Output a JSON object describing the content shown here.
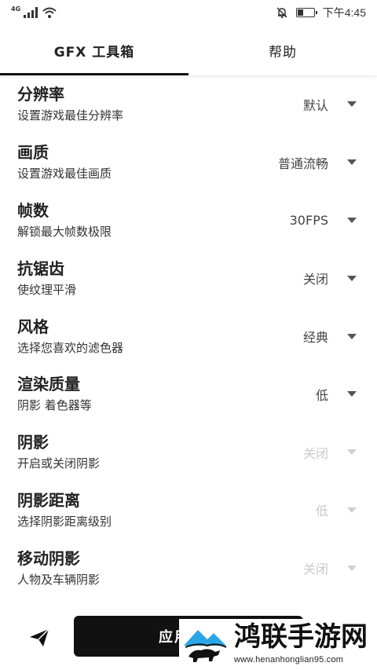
{
  "status_bar": {
    "network_label": "4G",
    "time": "下午4:45",
    "battery_level": 0.35,
    "icons": [
      "signal-icon",
      "wifi-icon",
      "mute-bell-icon",
      "battery-icon"
    ]
  },
  "tabs": [
    {
      "label": "GFX 工具箱",
      "active": true
    },
    {
      "label": "帮助",
      "active": false
    }
  ],
  "settings": [
    {
      "title": "分辨率",
      "subtitle": "设置游戏最佳分辨率",
      "value": "默认",
      "enabled": true
    },
    {
      "title": "画质",
      "subtitle": "设置游戏最佳画质",
      "value": "普通流畅",
      "enabled": true
    },
    {
      "title": "帧数",
      "subtitle": "解锁最大帧数极限",
      "value": "30FPS",
      "enabled": true
    },
    {
      "title": "抗锯齿",
      "subtitle": "使纹理平滑",
      "value": "关闭",
      "enabled": true
    },
    {
      "title": "风格",
      "subtitle": "选择您喜欢的滤色器",
      "value": "经典",
      "enabled": true
    },
    {
      "title": "渲染质量",
      "subtitle": "阴影 着色器等",
      "value": "低",
      "enabled": true
    },
    {
      "title": "阴影",
      "subtitle": "开启或关闭阴影",
      "value": "关闭",
      "enabled": false
    },
    {
      "title": "阴影距离",
      "subtitle": "选择阴影距离级别",
      "value": "低",
      "enabled": false
    },
    {
      "title": "移动阴影",
      "subtitle": "人物及车辆阴影",
      "value": "关闭",
      "enabled": false
    }
  ],
  "bottom": {
    "apply_label": "应用",
    "send_icon": "paper-plane-icon"
  },
  "watermark": {
    "text": "鸿联手游网",
    "url": "www.henanhonglian95.com",
    "colors": {
      "sky": "#2aa6e8",
      "text": "#111111"
    }
  }
}
